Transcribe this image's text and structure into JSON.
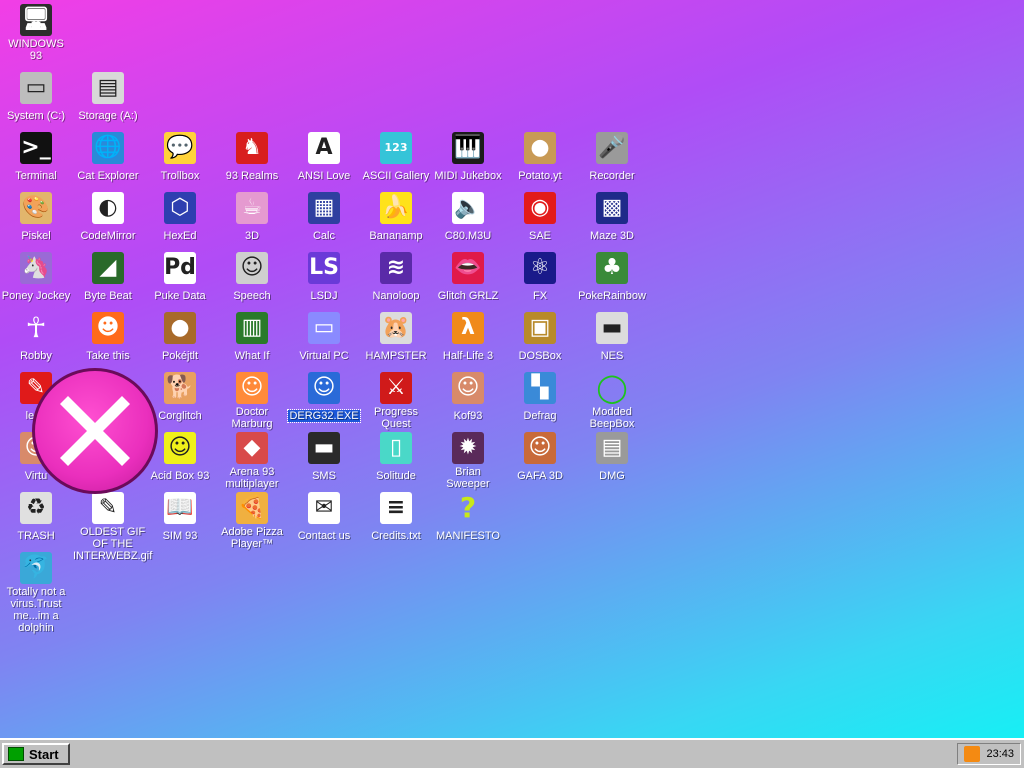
{
  "desktop": {
    "icons": [
      {
        "label": "WINDOWS 93",
        "icon": "computer-icon",
        "color": "#2d2d2d",
        "glyph": "🖥"
      },
      {
        "label": "System (C:)",
        "icon": "hard-drive-icon",
        "color": "#bdbdbd",
        "glyph": "▭"
      },
      {
        "label": "Storage (A:)",
        "icon": "floppy-drive-icon",
        "color": "#d8d8d8",
        "glyph": "▤"
      },
      {
        "label": "Terminal",
        "icon": "terminal-icon",
        "color": "#111111",
        "glyph": ">_"
      },
      {
        "label": "Cat Explorer",
        "icon": "cat-globe-icon",
        "color": "#2a8ad8",
        "glyph": "🌐"
      },
      {
        "label": "Trollbox",
        "icon": "chat-bubble-icon",
        "color": "#ffd23a",
        "glyph": "💬"
      },
      {
        "label": "93 Realms",
        "icon": "knight-icon",
        "color": "#d81e1e",
        "glyph": "♞"
      },
      {
        "label": "ANSI Love",
        "icon": "ansi-letter-icon",
        "color": "#ffffff",
        "glyph": "A"
      },
      {
        "label": "ASCII Gallery",
        "icon": "ascii-numbers-icon",
        "color": "#35c4d8",
        "glyph": "123"
      },
      {
        "label": "MIDI Jukebox",
        "icon": "piano-keys-icon",
        "color": "#1b1b1b",
        "glyph": "🎹"
      },
      {
        "label": "Potato.yt",
        "icon": "potato-icon",
        "color": "#c89a55",
        "glyph": "●"
      },
      {
        "label": "Recorder",
        "icon": "microphone-icon",
        "color": "#9a9a9a",
        "glyph": "🎤"
      },
      {
        "label": "Piskel",
        "icon": "paint-palette-icon",
        "color": "#e2b66c",
        "glyph": "🎨"
      },
      {
        "label": "CodeMirror",
        "icon": "codemirror-icon",
        "color": "#ffffff",
        "glyph": "◐"
      },
      {
        "label": "HexEd",
        "icon": "hex-cube-icon",
        "color": "#2e3fb0",
        "glyph": "⬡"
      },
      {
        "label": "3D",
        "icon": "teapot-icon",
        "color": "#e59ad0",
        "glyph": "☕"
      },
      {
        "label": "Calc",
        "icon": "calculator-icon",
        "color": "#2f3fa0",
        "glyph": "▦"
      },
      {
        "label": "Bananamp",
        "icon": "banana-icon",
        "color": "#ffe21a",
        "glyph": "🍌"
      },
      {
        "label": "C80.M3U",
        "icon": "audio-file-icon",
        "color": "#ffffff",
        "glyph": "🔈"
      },
      {
        "label": "SAE",
        "icon": "checkered-ball-icon",
        "color": "#e31b1b",
        "glyph": "◉"
      },
      {
        "label": "Maze 3D",
        "icon": "maze-icon",
        "color": "#1f2a8a",
        "glyph": "▩"
      },
      {
        "label": "Poney Jockey",
        "icon": "pony-icon",
        "color": "#9a6ad6",
        "glyph": "🦄"
      },
      {
        "label": "Byte Beat",
        "icon": "byte-beat-icon",
        "color": "#2a6a2a",
        "glyph": "◢"
      },
      {
        "label": "Puke Data",
        "icon": "pd-file-icon",
        "color": "#ffffff",
        "glyph": "Pd"
      },
      {
        "label": "Speech",
        "icon": "speech-face-icon",
        "color": "#cfcfcf",
        "glyph": "☺"
      },
      {
        "label": "LSDJ",
        "icon": "gameboy-icon",
        "color": "#6a3ad8",
        "glyph": "LS"
      },
      {
        "label": "Nanoloop",
        "icon": "waveform-icon",
        "color": "#5a2aa8",
        "glyph": "≋"
      },
      {
        "label": "Glitch GRLZ",
        "icon": "lips-icon",
        "color": "#e01a4a",
        "glyph": "👄"
      },
      {
        "label": "FX",
        "icon": "atom-icon",
        "color": "#1a1a8a",
        "glyph": "⚛"
      },
      {
        "label": "PokeRainbow",
        "icon": "pokemon-trainers-icon",
        "color": "#3a8a3a",
        "glyph": "♣"
      },
      {
        "label": "Robby",
        "icon": "stick-figure-icon",
        "color": "transparent",
        "glyph": "☥"
      },
      {
        "label": "Take this",
        "icon": "clown-icon",
        "color": "#ff6a1a",
        "glyph": "☻"
      },
      {
        "label": "Pokéjtlt",
        "icon": "cookie-icon",
        "color": "#a86a2a",
        "glyph": "●"
      },
      {
        "label": "What If",
        "icon": "book-pages-icon",
        "color": "#2a7a2a",
        "glyph": "▥"
      },
      {
        "label": "Virtual PC",
        "icon": "virtual-pc-icon",
        "color": "#8a8aff",
        "glyph": "▭"
      },
      {
        "label": "HAMPSTER",
        "icon": "hamster-icon",
        "color": "#dcdcdc",
        "glyph": "🐹"
      },
      {
        "label": "Half-Life 3",
        "icon": "half-life-icon",
        "color": "#f08a1a",
        "glyph": "λ"
      },
      {
        "label": "DOSBox",
        "icon": "dosbox-icon",
        "color": "#b88a2a",
        "glyph": "▣"
      },
      {
        "label": "NES",
        "icon": "nes-console-icon",
        "color": "#dcdcdc",
        "glyph": "▬"
      },
      {
        "label": "lenn",
        "icon": "pdf-file-icon",
        "color": "#e01a1a",
        "glyph": "✎"
      },
      {
        "label": "Corglitch",
        "icon": "corgi-icon",
        "color": "#e8a060",
        "glyph": "🐕"
      },
      {
        "label": "Doctor Marburg",
        "icon": "doctor-icon",
        "color": "#ff8a3a",
        "glyph": "☺"
      },
      {
        "label": "DERG32.EXE",
        "icon": "derg-robot-icon",
        "color": "#2a6ad8",
        "glyph": "☺"
      },
      {
        "label": "Progress Quest",
        "icon": "crossed-swords-icon",
        "color": "#d01a1a",
        "glyph": "⚔"
      },
      {
        "label": "Kof93",
        "icon": "fighter-portrait-icon",
        "color": "#d88a6a",
        "glyph": "☺"
      },
      {
        "label": "Defrag",
        "icon": "defrag-icon",
        "color": "#3a8ad8",
        "glyph": "▚"
      },
      {
        "label": "Modded BeepBox",
        "icon": "green-ring-icon",
        "color": "transparent",
        "glyph": "◯"
      },
      {
        "label": "Virtu",
        "icon": "virtual-girl-icon",
        "color": "#d88a6a",
        "glyph": "☺"
      },
      {
        "label": "Acid Box 93",
        "icon": "smiley-icon",
        "color": "#f0f01a",
        "glyph": "☺"
      },
      {
        "label": "Arena 93 multiplayer",
        "icon": "cube-icon",
        "color": "#d84a4a",
        "glyph": "◆"
      },
      {
        "label": "SMS",
        "icon": "sms-console-icon",
        "color": "#2a2a2a",
        "glyph": "▬"
      },
      {
        "label": "Solitude",
        "icon": "lantern-icon",
        "color": "#4ad8c8",
        "glyph": "▯"
      },
      {
        "label": "Brian Sweeper",
        "icon": "mine-icon",
        "color": "#5a2a5a",
        "glyph": "✹"
      },
      {
        "label": "GAFA 3D",
        "icon": "doom-face-icon",
        "color": "#c86a3a",
        "glyph": "☺"
      },
      {
        "label": "DMG",
        "icon": "cassette-icon",
        "color": "#9a9a9a",
        "glyph": "▤"
      },
      {
        "label": "TRASH",
        "icon": "recycle-bin-icon",
        "color": "#e0e0e0",
        "glyph": "♻"
      },
      {
        "label": "OLDEST GIF OF THE INTERWEBZ.gif",
        "icon": "gif-file-icon",
        "color": "#ffffff",
        "glyph": "✎"
      },
      {
        "label": "SIM 93",
        "icon": "sim-book-icon",
        "color": "#ffffff",
        "glyph": "📖"
      },
      {
        "label": "Adobe Pizza Player™",
        "icon": "pizza-icon",
        "color": "#f0b040",
        "glyph": "🍕"
      },
      {
        "label": "Contact us",
        "icon": "contact-note-icon",
        "color": "#ffffff",
        "glyph": "✉"
      },
      {
        "label": "Credits.txt",
        "icon": "text-file-icon",
        "color": "#ffffff",
        "glyph": "≡"
      },
      {
        "label": "MANIFESTO",
        "icon": "question-mark-icon",
        "color": "transparent",
        "glyph": "?"
      },
      {
        "label": "Totally not a virus.Trust me...im a dolphin",
        "icon": "dolphin-icon",
        "color": "#3aa8d8",
        "glyph": "🐬"
      }
    ],
    "close_overlay_icon": "close-x-icon"
  },
  "taskbar": {
    "start_label": "Start",
    "clock": "23:43",
    "tray_icon": "rss-icon"
  },
  "colors": {
    "gradient_top_left": "#f23ee6",
    "gradient_bottom_right": "#10f4f4",
    "taskbar": "#c0c0c0",
    "selection": "#1b57d8",
    "close_circle": "#ea2fbd"
  }
}
